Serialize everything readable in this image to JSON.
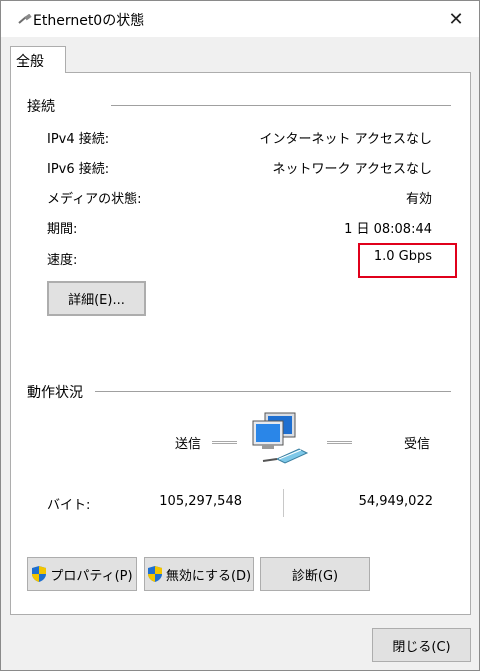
{
  "window": {
    "title": "Ethernet0の状態",
    "close_glyph": "✕"
  },
  "tabs": [
    {
      "label": "全般"
    }
  ],
  "connection": {
    "title": "接続",
    "rows": [
      {
        "label": "IPv4 接続:",
        "value": "インターネット アクセスなし"
      },
      {
        "label": "IPv6 接続:",
        "value": "ネットワーク アクセスなし"
      },
      {
        "label": "メディアの状態:",
        "value": "有効"
      },
      {
        "label": "期間:",
        "value": "1 日 08:08:44"
      },
      {
        "label": "速度:",
        "value": "1.0 Gbps"
      }
    ],
    "details_button": "詳細(E)..."
  },
  "activity": {
    "title": "動作状況",
    "sent_label": "送信",
    "received_label": "受信",
    "bytes_label": "バイト:",
    "bytes_sent": "105,297,548",
    "bytes_received": "54,949,022"
  },
  "buttons": {
    "properties": "プロパティ(P)",
    "disable": "無効にする(D)",
    "diagnose": "診断(G)",
    "close": "閉じる(C)"
  },
  "icons": {
    "title": "network-cable-icon",
    "network": "network-computers-icon",
    "shield": "uac-shield-icon"
  },
  "colors": {
    "highlight": "#e0001b",
    "accent": "#1a6fc4"
  }
}
